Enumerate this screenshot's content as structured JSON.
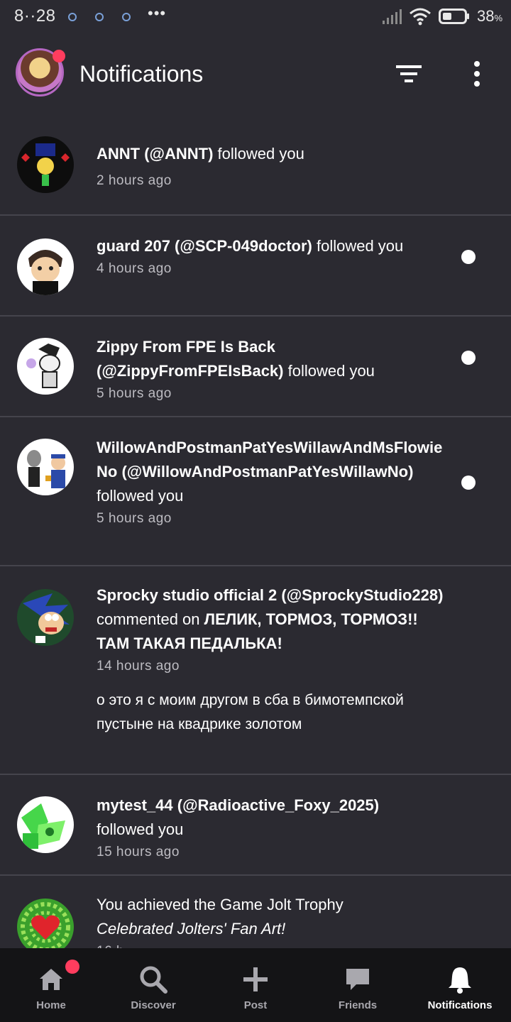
{
  "status_bar": {
    "time": "8··28",
    "battery": "38",
    "battery_unit": "%"
  },
  "header": {
    "title": "Notifications",
    "filter_icon": "filter-icon",
    "more_icon": "more-vertical-icon"
  },
  "notifications": [
    {
      "user": "ANNT (@ANNT)",
      "action": " followed you",
      "time": "2 hours ago",
      "unread": false
    },
    {
      "user": "guard 207 (@SCP-049doctor)",
      "action": " followed you",
      "time": "4 hours ago",
      "unread": true
    },
    {
      "user": "Zippy From FPE Is Back (@ZippyFromFPEIsBack)",
      "action": " followed you",
      "time": "5 hours ago",
      "unread": true
    },
    {
      "user": "WillowAndPostmanPatYesWillawAndMsFlowieNo (@WillowAndPostmanPatYesWillawNo)",
      "action": " followed you",
      "time": "5 hours ago",
      "unread": true
    },
    {
      "user": "Sprocky studio official 2 (@SprockyStudio228)",
      "action": " commented on ",
      "target": "ЛЕЛИК, ТОРМОЗ, ТОРМОЗ!! ТАМ ТАКАЯ ПЕДАЛЬКА!",
      "time": "14 hours ago",
      "comment": "о это я с моим другом в сба в бимотемпской пустыне на квадрике золотом",
      "unread": false
    },
    {
      "user": "mytest_44 (@Radioactive_Foxy_2025)",
      "action": " followed you",
      "time": "15 hours ago",
      "unread": false
    },
    {
      "prefix": "You achieved the Game Jolt Trophy ",
      "trophy": "Celebrated Jolters' Fan Art!",
      "time": "16 h",
      "unread": false
    }
  ],
  "bottom_nav": [
    {
      "label": "Home",
      "icon": "home-icon",
      "badge": true
    },
    {
      "label": "Discover",
      "icon": "search-icon",
      "badge": false
    },
    {
      "label": "Post",
      "icon": "plus-icon",
      "badge": false
    },
    {
      "label": "Friends",
      "icon": "chat-icon",
      "badge": false
    },
    {
      "label": "Notifications",
      "icon": "bell-icon",
      "badge": false,
      "active": true
    }
  ],
  "colors": {
    "background": "#2b2a31",
    "divider": "#45444c",
    "badge": "#ff3d5e",
    "nav_background": "#141416"
  }
}
